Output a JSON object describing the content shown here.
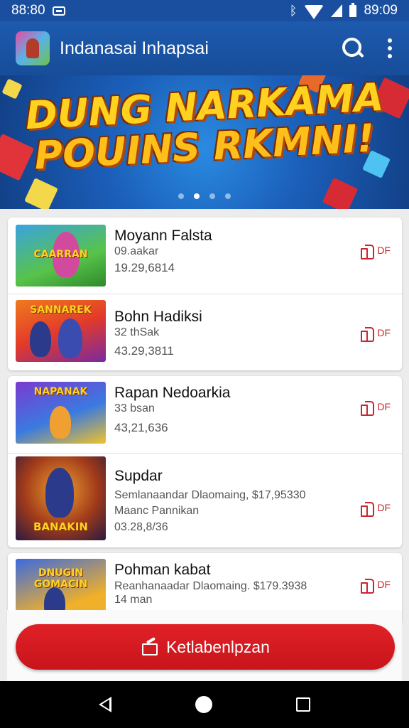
{
  "status_bar": {
    "time_left": "88:80",
    "time_right": "89:09"
  },
  "app_bar": {
    "title": "Indanasai Inhapsai"
  },
  "banner": {
    "line1": "DUNG NARKAMA",
    "line2": "POUINS RKMNI!",
    "dots": 4,
    "active_dot": 1
  },
  "cards": [
    {
      "items": [
        {
          "thumb_text": "CAARRAN",
          "title": "Moyann Falsta",
          "sub1": "09.aakar",
          "sub2": "19.29,6814",
          "like": "DF"
        },
        {
          "thumb_text": "SANNAREK",
          "title": "Bohn Hadiksi",
          "sub1": "32 thSak",
          "sub2": "43.29,3811",
          "like": "DF"
        }
      ]
    },
    {
      "items": [
        {
          "thumb_text": "NAPANAK",
          "title": "Rapan Nedoarkia",
          "sub1": "33 bsan",
          "sub2": "43,21,636",
          "like": "DF"
        },
        {
          "thumb_text": "BANAKIN",
          "title": "Supdar",
          "sub1": "Semlanaandar Dlaomaing, $17,95330",
          "sub2": "Maanc Pannikan",
          "sub3": "03.28,8/36",
          "like": "DF"
        }
      ]
    },
    {
      "items": [
        {
          "thumb_text": "DNUGIN GOMACIN",
          "title": "Pohman kabat",
          "sub1": "Reanhanaadar Dlaomaing. $179.3938",
          "sub2": "14 man",
          "like": "DF"
        }
      ]
    }
  ],
  "cta": {
    "label": "Ketlabenlpzan"
  },
  "colors": {
    "accent": "#c8262e",
    "app_bar": "#1d5aae",
    "cta": "#e02127"
  },
  "icons": [
    "message-icon",
    "wifi-icon",
    "cell-icon",
    "battery-icon",
    "search-icon",
    "more-icon",
    "like-icon",
    "edit-icon",
    "back-icon",
    "home-icon",
    "recent-apps-icon"
  ]
}
